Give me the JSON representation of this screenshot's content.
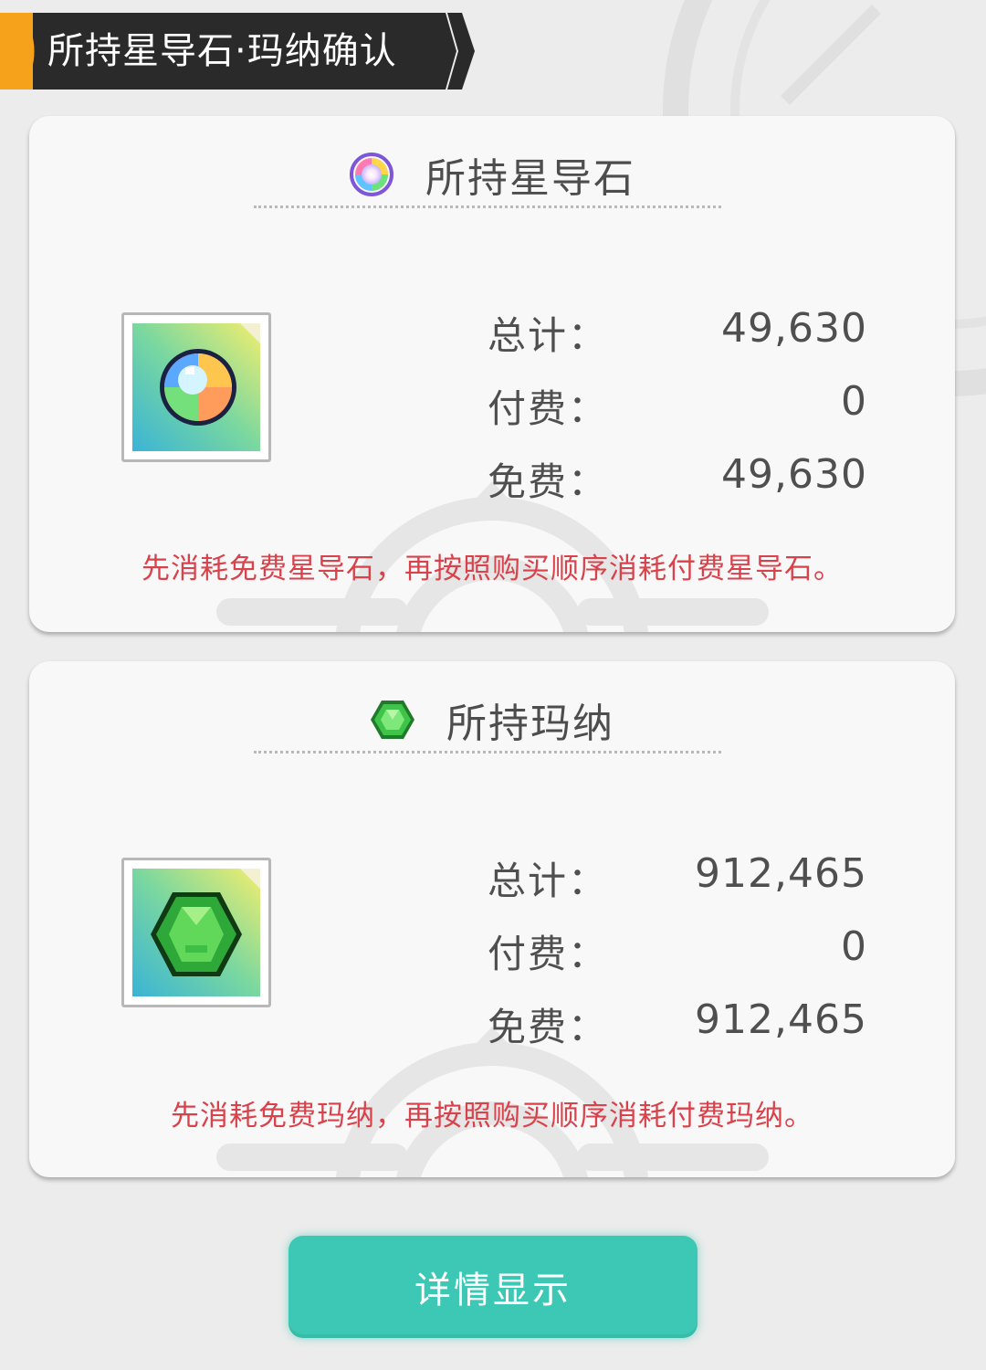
{
  "header": {
    "title": "所持星导石·玛纳确认"
  },
  "cards": [
    {
      "title": "所持星导石",
      "icon": "rainbow-star-stone-icon",
      "item_icon": "star-stone-pixel-icon",
      "rows": [
        {
          "label": "总计：",
          "value": "49,630"
        },
        {
          "label": "付费：",
          "value": "0"
        },
        {
          "label": "免费：",
          "value": "49,630"
        }
      ],
      "note": "先消耗免费星导石，再按照购买顺序消耗付费星导石。"
    },
    {
      "title": "所持玛纳",
      "icon": "green-mana-gem-icon",
      "item_icon": "mana-gem-pixel-icon",
      "rows": [
        {
          "label": "总计：",
          "value": "912,465"
        },
        {
          "label": "付费：",
          "value": "0"
        },
        {
          "label": "免费：",
          "value": "912,465"
        }
      ],
      "note": "先消耗免费玛纳，再按照购买顺序消耗付费玛纳。"
    }
  ],
  "button": {
    "label": "详情显示"
  },
  "colors": {
    "accent_orange": "#f7a21b",
    "button_teal": "#3cc8b4",
    "note_red": "#d9424b",
    "header_dark": "#2a2a2a"
  }
}
